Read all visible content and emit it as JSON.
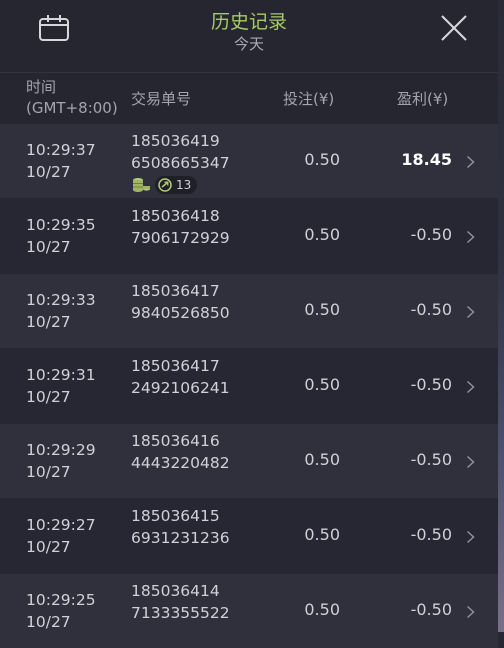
{
  "header": {
    "title": "历史记录",
    "subtitle": "今天"
  },
  "columns": {
    "time_line1": "时间",
    "time_line2": "(GMT+8:00)",
    "trade_id": "交易单号",
    "bet": "投注(¥)",
    "profit": "盈利(¥)"
  },
  "rows": [
    {
      "time": "10:29:37",
      "date": "10/27",
      "id_line1": "185036419",
      "id_line2": "6508665347",
      "bet": "0.50",
      "profit": "18.45",
      "badge_count": "13"
    },
    {
      "time": "10:29:35",
      "date": "10/27",
      "id_line1": "185036418",
      "id_line2": "7906172929",
      "bet": "0.50",
      "profit": "-0.50"
    },
    {
      "time": "10:29:33",
      "date": "10/27",
      "id_line1": "185036417",
      "id_line2": "9840526850",
      "bet": "0.50",
      "profit": "-0.50"
    },
    {
      "time": "10:29:31",
      "date": "10/27",
      "id_line1": "185036417",
      "id_line2": "2492106241",
      "bet": "0.50",
      "profit": "-0.50"
    },
    {
      "time": "10:29:29",
      "date": "10/27",
      "id_line1": "185036416",
      "id_line2": "4443220482",
      "bet": "0.50",
      "profit": "-0.50"
    },
    {
      "time": "10:29:27",
      "date": "10/27",
      "id_line1": "185036415",
      "id_line2": "6931231236",
      "bet": "0.50",
      "profit": "-0.50"
    },
    {
      "time": "10:29:25",
      "date": "10/27",
      "id_line1": "185036414",
      "id_line2": "7133355522",
      "bet": "0.50",
      "profit": "-0.50"
    }
  ],
  "icons": {
    "calendar": "calendar-icon",
    "close": "close-icon",
    "chevron": "chevron-right-icon",
    "coins": "coin-stack-icon",
    "free_spin": "spin-icon"
  },
  "colors": {
    "title": "#a7c96a",
    "background": "#262732",
    "row_alt": "#2f303b",
    "win": "#ffffff"
  }
}
